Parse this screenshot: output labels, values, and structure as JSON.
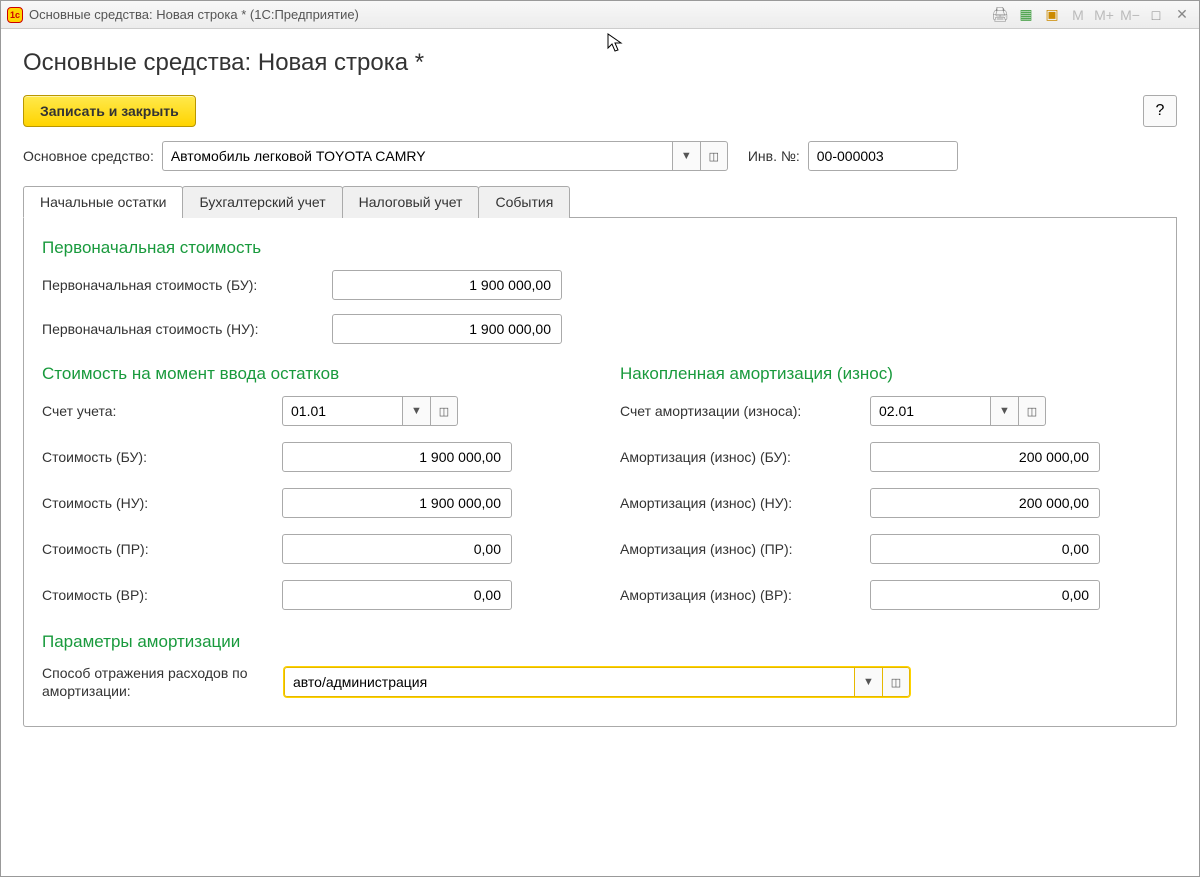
{
  "titlebar": {
    "title": "Основные средства: Новая строка *  (1С:Предприятие)"
  },
  "page": {
    "heading": "Основные средства: Новая строка *",
    "save_close": "Записать и закрыть",
    "help": "?"
  },
  "main_asset": {
    "label": "Основное средство:",
    "value": "Автомобиль легковой TOYOTA CAMRY",
    "inv_label": "Инв. №:",
    "inv_value": "00-000003"
  },
  "tabs": {
    "t0": "Начальные остатки",
    "t1": "Бухгалтерский учет",
    "t2": "Налоговый учет",
    "t3": "События"
  },
  "initial_cost": {
    "title": "Первоначальная стоимость",
    "bu_label": "Первоначальная стоимость (БУ):",
    "bu_value": "1 900 000,00",
    "nu_label": "Первоначальная стоимость (НУ):",
    "nu_value": "1 900 000,00"
  },
  "balance_cost": {
    "title": "Стоимость на момент ввода остатков",
    "acct_label": "Счет учета:",
    "acct_value": "01.01",
    "bu_label": "Стоимость (БУ):",
    "bu_value": "1 900 000,00",
    "nu_label": "Стоимость (НУ):",
    "nu_value": "1 900 000,00",
    "pr_label": "Стоимость (ПР):",
    "pr_value": "0,00",
    "vr_label": "Стоимость (ВР):",
    "vr_value": "0,00"
  },
  "amort": {
    "title": "Накопленная амортизация (износ)",
    "acct_label": "Счет амортизации (износа):",
    "acct_value": "02.01",
    "bu_label": "Амортизация (износ) (БУ):",
    "bu_value": "200 000,00",
    "nu_label": "Амортизация (износ) (НУ):",
    "nu_value": "200 000,00",
    "pr_label": "Амортизация (износ) (ПР):",
    "pr_value": "0,00",
    "vr_label": "Амортизация (износ) (ВР):",
    "vr_value": "0,00"
  },
  "params": {
    "title": "Параметры амортизации",
    "expense_label": "Способ отражения расходов по амортизации:",
    "expense_value": "авто/администрация"
  }
}
